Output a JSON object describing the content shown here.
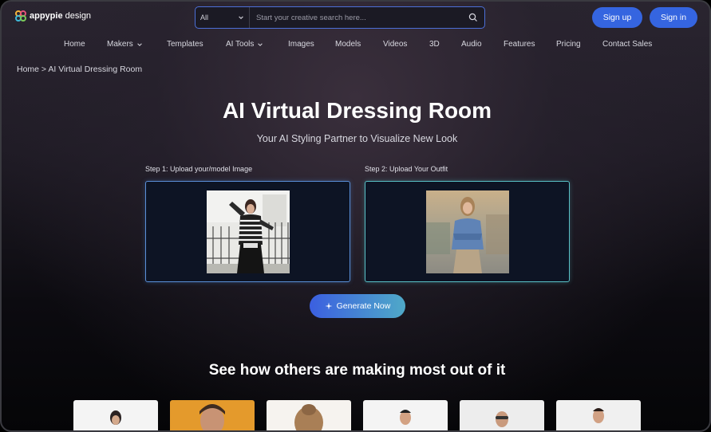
{
  "brand": {
    "name_bold": "appypie",
    "name_rest": " design"
  },
  "search": {
    "category": "All",
    "placeholder": "Start your creative search here..."
  },
  "auth": {
    "signup_label": "Sign up",
    "signin_label": "Sign in"
  },
  "nav": {
    "items": [
      {
        "label": "Home",
        "dropdown": false
      },
      {
        "label": "Makers",
        "dropdown": true
      },
      {
        "label": "Templates",
        "dropdown": false
      },
      {
        "label": "AI Tools",
        "dropdown": true
      },
      {
        "label": "Images",
        "dropdown": false
      },
      {
        "label": "Models",
        "dropdown": false
      },
      {
        "label": "Videos",
        "dropdown": false
      },
      {
        "label": "3D",
        "dropdown": false
      },
      {
        "label": "Audio",
        "dropdown": false
      },
      {
        "label": "Features",
        "dropdown": false
      },
      {
        "label": "Pricing",
        "dropdown": false
      },
      {
        "label": "Contact Sales",
        "dropdown": false
      }
    ]
  },
  "breadcrumb": {
    "text": "Home > AI Virtual Dressing Room"
  },
  "hero": {
    "title": "AI Virtual Dressing Room",
    "subtitle": "Your AI Styling Partner to Visualize New Look"
  },
  "steps": {
    "step1_label": "Step 1: Upload your/model Image",
    "step2_label": "Step 2: Upload Your Outfit"
  },
  "generate": {
    "label": "Generate Now"
  },
  "showcase": {
    "title": "See how others are making most out of it"
  },
  "colors": {
    "accent": "#3565e0",
    "gradient_end": "#4fa9c8",
    "box1_border": "#5a8fd8",
    "box2_border": "#58c0c6"
  },
  "icons": {
    "search": "search-icon",
    "chevron": "chevron-down-icon",
    "sparkle": "sparkle-icon"
  }
}
